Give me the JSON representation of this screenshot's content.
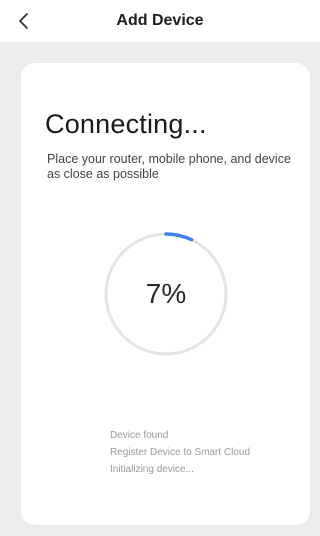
{
  "header": {
    "back_icon": "chevron-left-icon",
    "title": "Add Device"
  },
  "card": {
    "heading": "Connecting...",
    "description": "Place your router, mobile phone, and device as close as possible",
    "progress": {
      "value": 0.07,
      "label": "7%"
    },
    "steps": [
      "Device found",
      "Register Device to Smart Cloud",
      "Initializing device..."
    ]
  },
  "colors": {
    "accent": "#3d84e8",
    "track": "#e4e4e4",
    "background": "#ececec",
    "card": "#ffffff"
  }
}
